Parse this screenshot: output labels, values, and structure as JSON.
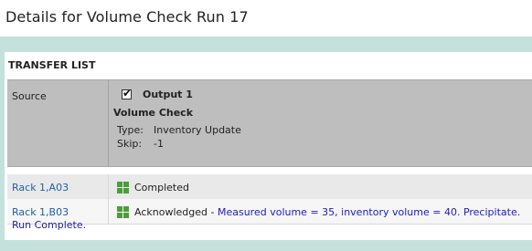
{
  "page": {
    "title": "Details for Volume Check Run 17"
  },
  "panel": {
    "title": "TRANSFER LIST",
    "header": {
      "source_label": "Source",
      "checkbox_mark": "✔",
      "output_label": "Output 1",
      "step_name": "Volume Check",
      "type_label": "Type:",
      "type_value": "Inventory Update",
      "skip_label": "Skip:",
      "skip_value": "-1"
    },
    "rows": [
      {
        "source": "Rack 1,A03",
        "status": "Completed",
        "separator": "",
        "comment": ""
      },
      {
        "source": "Rack 1,B03",
        "status": "Acknowledged",
        "separator": " - ",
        "comment": "Measured volume = 35, inventory volume = 40. Precipitate."
      }
    ],
    "footer": "Run Complete."
  },
  "colors": {
    "outer_bg": "#c5e1dc",
    "header_bg": "#bebebe",
    "link": "#1f5fa8",
    "comment": "#1c1cc0",
    "status_icon": "#4a9e3a"
  },
  "icons": {
    "status": "green-grid-icon"
  }
}
